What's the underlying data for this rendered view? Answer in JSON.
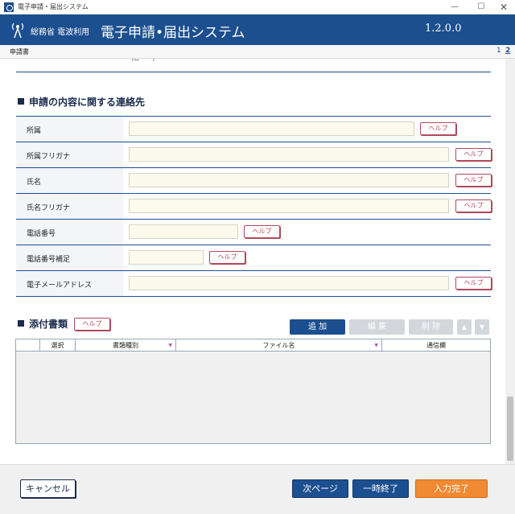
{
  "window": {
    "title": "電子申請・届出システム",
    "controls": {
      "minimize": "—",
      "maximize": "☐",
      "close": "✕"
    }
  },
  "header": {
    "ministry": "総務省 電波利用",
    "system_title": "電子申請•届出システム",
    "version": "1.2.0.0"
  },
  "pagebar": {
    "document_name": "申請書",
    "pages": [
      "1",
      "2"
    ]
  },
  "previous_section": {
    "cut_text": "(⊏ - - )"
  },
  "contact_section": {
    "title": "申請の内容に関する連絡先",
    "help_label": "ヘルプ",
    "fields": [
      {
        "label": "所属",
        "value": ""
      },
      {
        "label": "所属フリガナ",
        "value": ""
      },
      {
        "label": "氏名",
        "value": ""
      },
      {
        "label": "氏名フリガナ",
        "value": ""
      },
      {
        "label": "電話番号",
        "value": ""
      },
      {
        "label": "電話番号補足",
        "value": ""
      },
      {
        "label": "電子メールアドレス",
        "value": ""
      }
    ]
  },
  "attachments": {
    "title": "添付書類",
    "help_label": "ヘルプ",
    "buttons": {
      "add": "追 加",
      "edit": "編 集",
      "delete": "削 除",
      "up": "▲",
      "down": "▼"
    },
    "columns": [
      "",
      "選択",
      "書類種別",
      "ファイル名",
      "通信欄"
    ],
    "rows": []
  },
  "footer": {
    "cancel": "キャンセル",
    "next_page": "次ページ",
    "pause": "一時終了",
    "complete": "入力完了"
  },
  "colors": {
    "header_blue": "#1c4f8f",
    "help_border": "#b0485a",
    "field_bg": "#fbfaed",
    "complete_orange": "#f08a33"
  }
}
